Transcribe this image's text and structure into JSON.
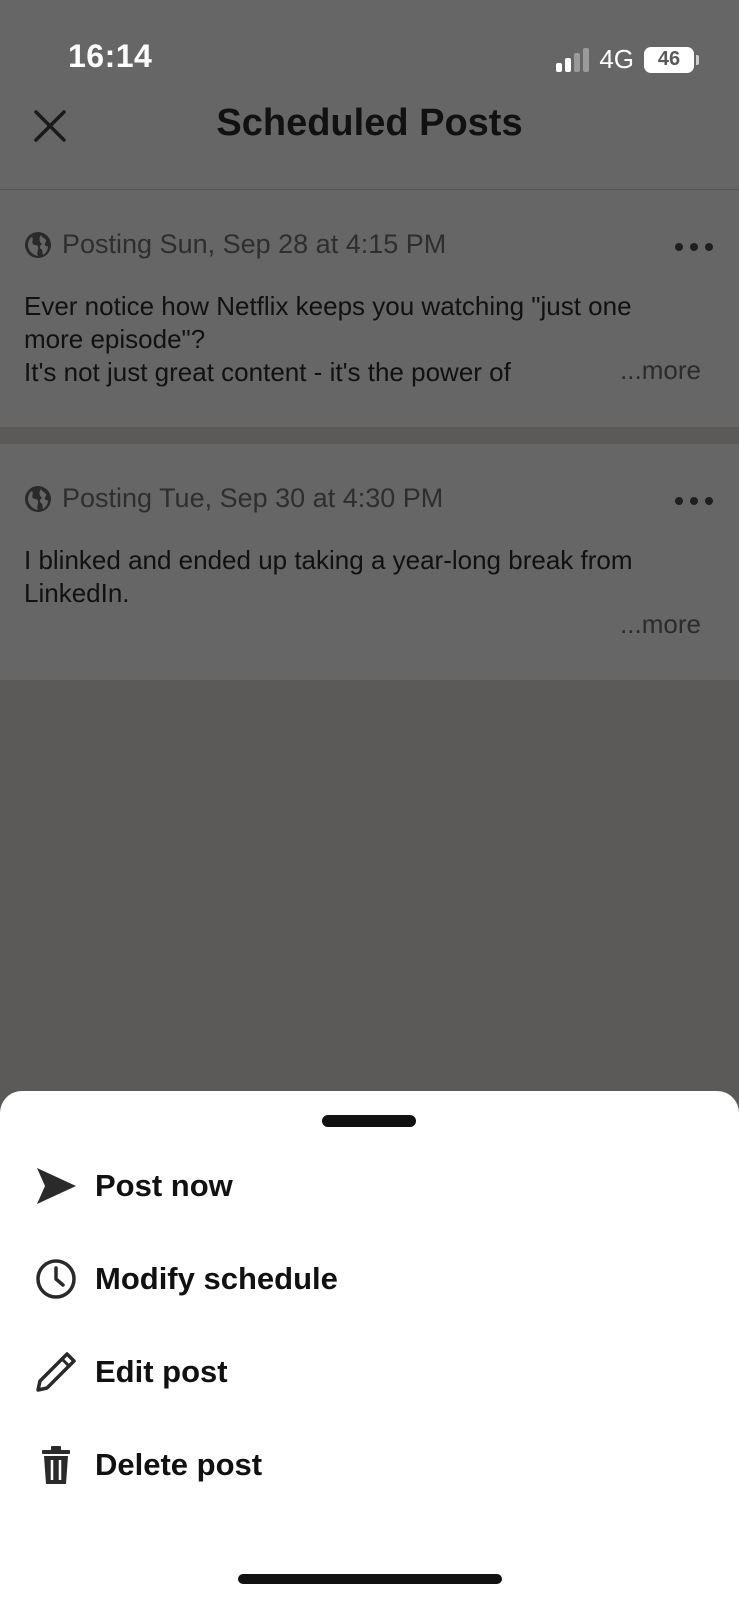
{
  "status_bar": {
    "time": "16:14",
    "network": "4G",
    "battery": "46"
  },
  "header": {
    "close_icon": "close-icon",
    "title": "Scheduled Posts"
  },
  "posts": [
    {
      "schedule": "Posting Sun, Sep 28 at 4:15 PM",
      "lines": [
        "Ever notice how Netflix keeps you watching \"just one",
        "more episode\"?",
        "It's not just great content - it's the power of"
      ],
      "more": "...more"
    },
    {
      "schedule": "Posting Tue, Sep 30 at 4:30 PM",
      "lines": [
        "I blinked and ended up taking a year-long break from",
        "LinkedIn."
      ],
      "more": "...more"
    }
  ],
  "sheet": {
    "actions": [
      {
        "label": "Post now",
        "icon": "send-icon"
      },
      {
        "label": "Modify schedule",
        "icon": "clock-icon"
      },
      {
        "label": "Edit post",
        "icon": "pencil-icon"
      },
      {
        "label": "Delete post",
        "icon": "trash-icon"
      }
    ]
  },
  "colors": {
    "overlay": "#5b5a59",
    "dimmed_surface": "#666666",
    "sheet_background": "#ffffff",
    "text_primary": "#111111"
  }
}
